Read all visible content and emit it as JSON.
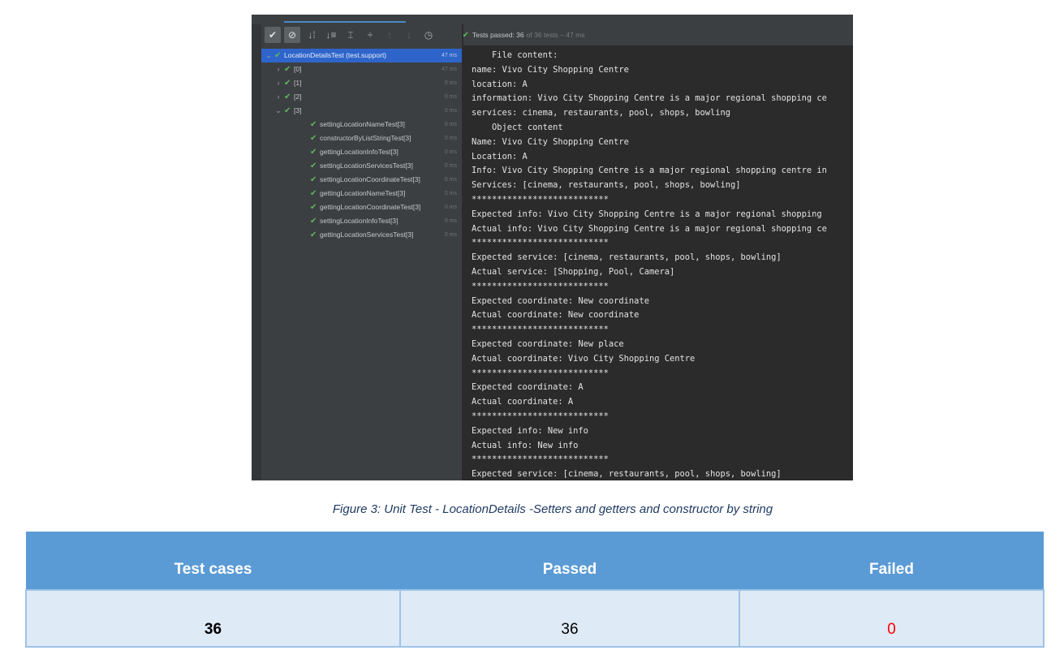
{
  "ide": {
    "toolbar_icons": [
      "check-toggle-icon",
      "cancel-toggle-icon",
      "sort-alpha-icon",
      "sort-duration-icon",
      "expand-all-icon",
      "collapse-all-icon",
      "previous-test-icon",
      "next-test-icon",
      "history-icon"
    ],
    "status": {
      "expand_glyph": "»",
      "passed_label": "Tests passed: 36",
      "passed_suffix": "of 36 tests – 47 ms"
    },
    "tree": [
      {
        "arrow": "⌄",
        "label": "LocationDetailsTest (test.support)",
        "duration": "47 ms",
        "indent": 0,
        "selected": true
      },
      {
        "arrow": "›",
        "label": "[0]",
        "duration": "47 ms",
        "indent": 1
      },
      {
        "arrow": "›",
        "label": "[1]",
        "duration": "0 ms",
        "indent": 1
      },
      {
        "arrow": "›",
        "label": "[2]",
        "duration": "0 ms",
        "indent": 1
      },
      {
        "arrow": "⌄",
        "label": "[3]",
        "duration": "0 ms",
        "indent": 1
      },
      {
        "label": "settingLocationNameTest[3]",
        "duration": "0 ms",
        "indent": 2
      },
      {
        "label": "constructorByListStringTest[3]",
        "duration": "0 ms",
        "indent": 2
      },
      {
        "label": "gettingLocationInfoTest[3]",
        "duration": "0 ms",
        "indent": 2
      },
      {
        "label": "settingLocationServicesTest[3]",
        "duration": "0 ms",
        "indent": 2
      },
      {
        "label": "settingLocationCoordinateTest[3]",
        "duration": "0 ms",
        "indent": 2
      },
      {
        "label": "gettingLocationNameTest[3]",
        "duration": "0 ms",
        "indent": 2
      },
      {
        "label": "gettingLocationCoordinateTest[3]",
        "duration": "0 ms",
        "indent": 2
      },
      {
        "label": "settingLocationInfoTest[3]",
        "duration": "0 ms",
        "indent": 2
      },
      {
        "label": "gettingLocationServicesTest[3]",
        "duration": "0 ms",
        "indent": 2
      }
    ],
    "console": [
      "    File content:",
      "name: Vivo City Shopping Centre",
      "location: A",
      "information: Vivo City Shopping Centre is a major regional shopping ce",
      "services: cinema, restaurants, pool, shops, bowling",
      "    Object content",
      "Name: Vivo City Shopping Centre",
      "Location: A",
      "Info: Vivo City Shopping Centre is a major regional shopping centre in",
      "Services: [cinema, restaurants, pool, shops, bowling]",
      "***************************",
      "Expected info: Vivo City Shopping Centre is a major regional shopping",
      "Actual info: Vivo City Shopping Centre is a major regional shopping ce",
      "***************************",
      "Expected service: [cinema, restaurants, pool, shops, bowling]",
      "Actual service: [Shopping, Pool, Camera]",
      "***************************",
      "Expected coordinate: New coordinate",
      "Actual coordinate: New coordinate",
      "***************************",
      "Expected coordinate: New place",
      "Actual coordinate: Vivo City Shopping Centre",
      "***************************",
      "Expected coordinate: A",
      "Actual coordinate: A",
      "***************************",
      "Expected info: New info",
      "Actual info: New info",
      "***************************",
      "Expected service: [cinema, restaurants, pool, shops, bowling]"
    ]
  },
  "caption": "Figure 3: Unit Test - LocationDetails -Setters and getters and constructor by string",
  "results_table": {
    "headers": [
      "Test cases",
      "Passed",
      "Failed"
    ],
    "row": [
      "36",
      "36",
      "0"
    ],
    "colors": {
      "header_bg": "#5b9bd5",
      "cell_bg": "#deeaf6",
      "failed_value": "#ff0000"
    }
  }
}
